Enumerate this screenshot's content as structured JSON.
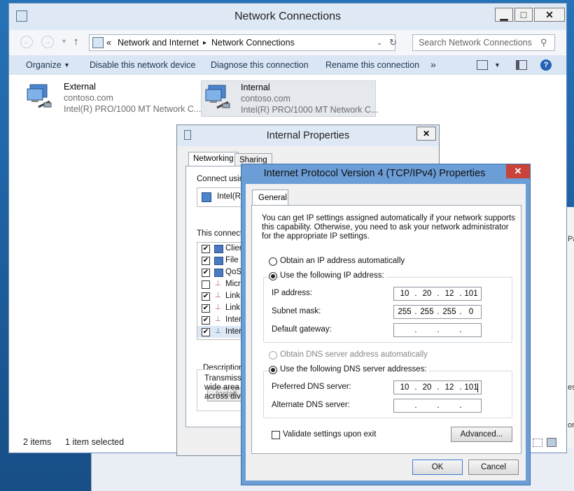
{
  "explorer": {
    "title": "Network Connections",
    "nav": {
      "breadcrumb_overflow": "«",
      "crumbs": [
        "Network and Internet",
        "Network Connections"
      ],
      "crumb_separator": "▸",
      "search_placeholder": "Search Network Connections"
    },
    "commands": [
      "Organize",
      "Disable this network device",
      "Diagnose this connection",
      "Rename this connection"
    ],
    "more_glyph": "»",
    "adapters": [
      {
        "name": "External",
        "domain": "contoso.com",
        "device": "Intel(R) PRO/1000 MT Network C..."
      },
      {
        "name": "Internal",
        "domain": "contoso.com",
        "device": "Intel(R) PRO/1000 MT Network C...",
        "selected": true
      }
    ],
    "status": {
      "count": "2 items",
      "selection": "1 item selected"
    }
  },
  "props": {
    "title": "Internal Properties",
    "tabs": [
      "Networking",
      "Sharing"
    ],
    "connect_using": "Connect using",
    "adapter": "Intel(R)",
    "this_connection": "This connecti",
    "items": [
      {
        "label": "Clien",
        "checked": true
      },
      {
        "label": "File a",
        "checked": true
      },
      {
        "label": "QoS",
        "checked": true
      },
      {
        "label": "Micr",
        "checked": false
      },
      {
        "label": "Link",
        "checked": true
      },
      {
        "label": "Link",
        "checked": true
      },
      {
        "label": "Inter",
        "checked": true
      },
      {
        "label": "Inter",
        "checked": true
      }
    ],
    "install": "Install...",
    "description_label": "Description",
    "description_lines": [
      "Transmissi",
      "wide area n",
      "across dive"
    ]
  },
  "ipv4": {
    "title": "Internet Protocol Version 4 (TCP/IPv4) Properties",
    "close_glyph": "✕",
    "tab": "General",
    "intro": [
      "You can get IP settings assigned automatically if your network supports",
      "this capability. Otherwise, you need to ask your network administrator",
      "for the appropriate IP settings."
    ],
    "ip_auto": "Obtain an IP address automatically",
    "ip_manual": "Use the following IP address:",
    "ip_address_label": "IP address:",
    "ip_address": [
      "10",
      "20",
      "12",
      "101"
    ],
    "subnet_label": "Subnet mask:",
    "subnet": [
      "255",
      "255",
      "255",
      "0"
    ],
    "gateway_label": "Default gateway:",
    "gateway": [
      "",
      "",
      "",
      ""
    ],
    "dns_auto": "Obtain DNS server address automatically",
    "dns_manual": "Use the following DNS server addresses:",
    "preferred_label": "Preferred DNS server:",
    "preferred": [
      "10",
      "20",
      "12",
      "101"
    ],
    "alternate_label": "Alternate DNS server:",
    "alternate": [
      "",
      "",
      "",
      ""
    ],
    "validate": "Validate settings upon exit",
    "advanced": "Advanced...",
    "ok": "OK",
    "cancel": "Cancel"
  },
  "background": {
    "frag_1": "Pa",
    "frag_2": "es",
    "frag_3": "or"
  }
}
